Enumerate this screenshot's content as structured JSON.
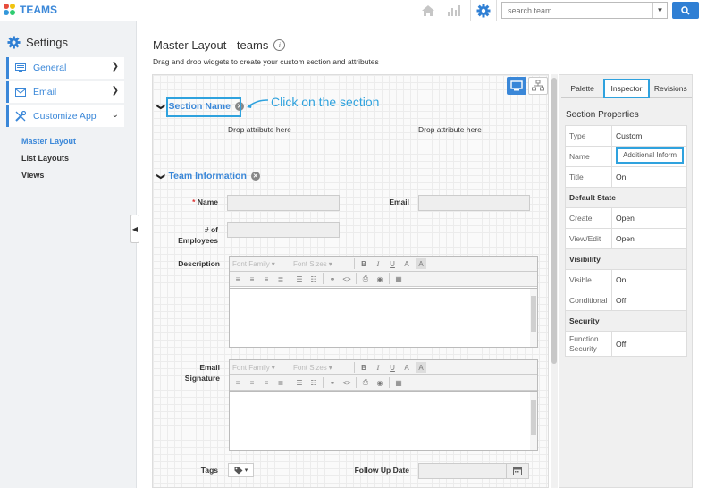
{
  "app": {
    "title": "TEAMS"
  },
  "search": {
    "placeholder": "search team"
  },
  "sidebar": {
    "title": "Settings",
    "items": [
      {
        "label": "General"
      },
      {
        "label": "Email"
      },
      {
        "label": "Customize App"
      }
    ],
    "subnav": [
      {
        "label": "Master Layout"
      },
      {
        "label": "List Layouts"
      },
      {
        "label": "Views"
      }
    ]
  },
  "main": {
    "title": "Master Layout - teams",
    "subtitle": "Drag and drop widgets to create your custom section and attributes",
    "annotation": "Click on the section",
    "section_name": {
      "title": "Section Name",
      "drop_left": "Drop attribute here",
      "drop_right": "Drop attribute here"
    },
    "team_info": {
      "title": "Team Information",
      "fields": {
        "name": "Name",
        "email": "Email",
        "employees_1": "# of",
        "employees_2": "Employees",
        "description": "Description",
        "signature_1": "Email",
        "signature_2": "Signature",
        "tags": "Tags",
        "follow_up": "Follow Up Date"
      }
    },
    "editor": {
      "font_family": "Font Family",
      "font_sizes": "Font Sizes"
    }
  },
  "inspector": {
    "tabs": [
      {
        "label": "Palette"
      },
      {
        "label": "Inspector"
      },
      {
        "label": "Revisions"
      }
    ],
    "title": "Section Properties",
    "rows": {
      "type_k": "Type",
      "type_v": "Custom",
      "name_k": "Name",
      "name_v": "Additional Inform",
      "title_k": "Title",
      "title_v": "On",
      "default_state": "Default State",
      "create_k": "Create",
      "create_v": "Open",
      "viewedit_k": "View/Edit",
      "viewedit_v": "Open",
      "visibility": "Visibility",
      "visible_k": "Visible",
      "visible_v": "On",
      "conditional_k": "Conditional",
      "conditional_v": "Off",
      "security": "Security",
      "function_k1": "Function",
      "function_k2": "Security",
      "function_v": "Off"
    }
  },
  "colors": {
    "accent": "#3a87d8",
    "highlight": "#2fa2de"
  }
}
